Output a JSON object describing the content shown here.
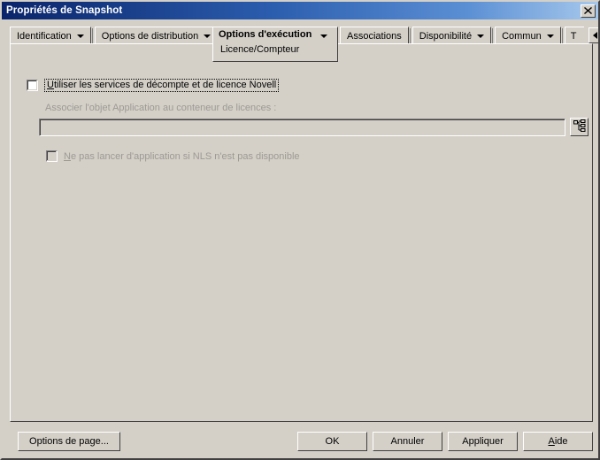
{
  "window": {
    "title": "Propriétés de Snapshot",
    "close_icon": "close-icon"
  },
  "tabs": {
    "items": [
      {
        "label": "Identification",
        "has_dropdown": true,
        "selected": false
      },
      {
        "label": "Options de distribution",
        "has_dropdown": true,
        "selected": false
      },
      {
        "label": "Associations",
        "has_dropdown": false,
        "selected": false
      },
      {
        "label": "Disponibilité",
        "has_dropdown": true,
        "selected": false
      },
      {
        "label": "Commun",
        "has_dropdown": true,
        "selected": false
      }
    ],
    "selected_tab": {
      "label": "Options d'exécution",
      "has_dropdown": true,
      "subtab": "Licence/Compteur"
    },
    "partial_tab": "T",
    "scroll_left_icon": "arrow-left-icon",
    "scroll_right_icon": "arrow-right-icon"
  },
  "main": {
    "use_nls_checkbox": {
      "label_before": "U",
      "label_after": "tiliser les services de décompte et de licence Novell",
      "checked": false,
      "focused": true
    },
    "assoc_label": "Associer l'objet Application au conteneur de licences :",
    "assoc_field_value": "",
    "browse_button_icon": "tree-browse-icon",
    "no_launch_checkbox": {
      "label_before": "N",
      "label_after": "e pas lancer d'application si NLS n'est pas disponible",
      "checked": false,
      "disabled": true
    }
  },
  "buttons": {
    "page_options": "Options de page...",
    "ok": "OK",
    "cancel": "Annuler",
    "apply": "Appliquer",
    "help_before": "A",
    "help_after": "ide"
  },
  "colors": {
    "face": "#d4d0c8",
    "title_start": "#0a246a",
    "title_end": "#a6c8ec",
    "disabled_text": "#9d9a94"
  }
}
